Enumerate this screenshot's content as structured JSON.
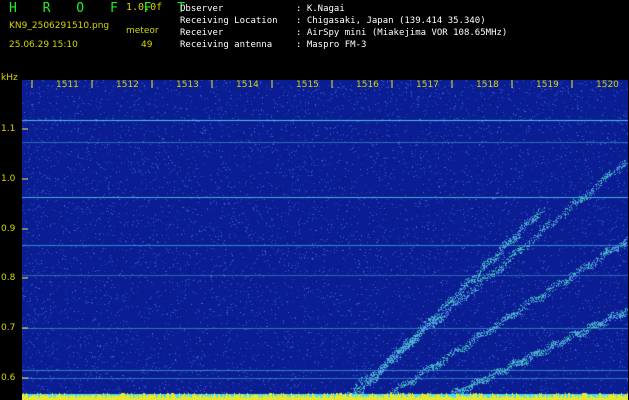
{
  "header": {
    "logo": "H R O F F T",
    "version": "1.0.0f",
    "filename": "KN9_2506291510.png",
    "mode": "meteor",
    "date": "25.06.29 15:10",
    "count": "49"
  },
  "metadata": [
    {
      "label": "Observer",
      "value": ": K.Nagai"
    },
    {
      "label": "Receiving Location",
      "value": ": Chigasaki, Japan (139.414 35.340)"
    },
    {
      "label": "Receiver",
      "value": ": AirSpy mini (Miakejima VOR 108.65MHz)"
    },
    {
      "label": "Receiving antenna",
      "value": ": Maspro FM-3"
    }
  ],
  "spectrogram": {
    "y_unit": "kHz",
    "y_ticks": [
      "1.1",
      "1.0",
      "0.9",
      "0.8",
      "0.7",
      "0.6"
    ],
    "x_ticks": [
      "1511",
      "1512",
      "1513",
      "1514",
      "1515",
      "1516",
      "1517",
      "1518",
      "1519",
      "1520"
    ],
    "colors": {
      "background": "#0a1d93",
      "noise": "#3a64e6",
      "carrier": "#50d0e8",
      "trace": "#30c8a8",
      "baseline": "#e8e830",
      "baseline_glow": "#40e0ff"
    }
  }
}
